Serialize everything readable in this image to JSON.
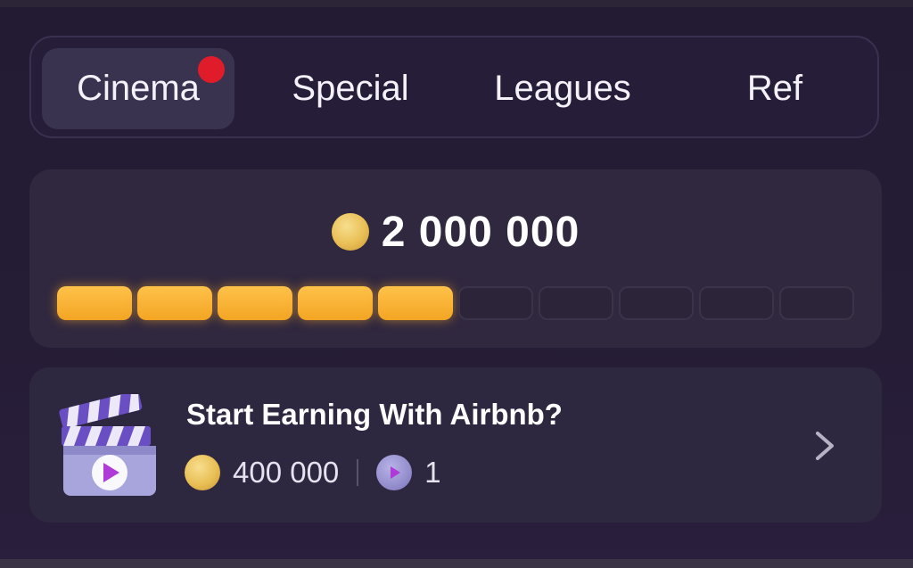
{
  "tabs": [
    {
      "label": "Cinema",
      "active": true,
      "has_notification": true
    },
    {
      "label": "Special",
      "active": false
    },
    {
      "label": "Leagues",
      "active": false
    },
    {
      "label": "Ref",
      "active": false
    }
  ],
  "balance": {
    "value": "2 000 000",
    "progress_filled_segments": 5,
    "progress_total_segments": 10
  },
  "task": {
    "title": "Start Earning With Airbnb?",
    "coin_reward": "400 000",
    "ticket_reward": "1"
  },
  "colors": {
    "background": "#231b33",
    "progress_fill": "#f3a523",
    "notification_dot": "#e01c2a",
    "coin": "#e9bf55"
  },
  "icons": [
    "coin-icon",
    "clapperboard-icon",
    "play-ticket-icon",
    "chevron-right-icon"
  ]
}
